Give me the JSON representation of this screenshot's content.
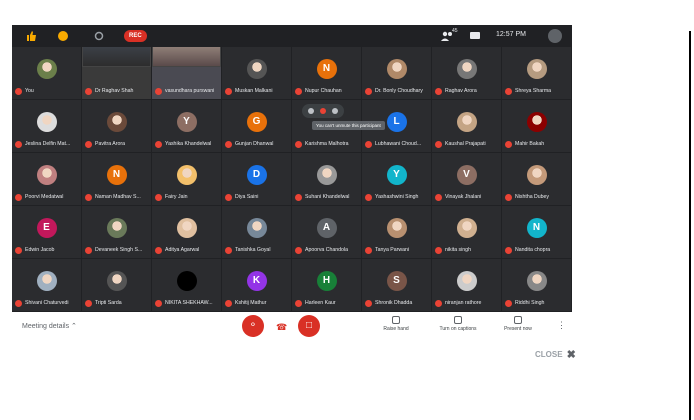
{
  "topbar": {
    "rec_label": "REC",
    "time": "12:57 PM",
    "participant_count": "45"
  },
  "tiles": [
    {
      "name": "You",
      "type": "photo",
      "color": "#6b7f4a"
    },
    {
      "name": "Dr Raghav Shah",
      "type": "video"
    },
    {
      "name": "vasundhara purswani",
      "type": "video"
    },
    {
      "name": "Muskan Malkani",
      "type": "photo",
      "color": "#555"
    },
    {
      "name": "Nupur Chauhan",
      "type": "letter",
      "letter": "N",
      "color": "#e8710a"
    },
    {
      "name": "Dr. Bonly Choudhary",
      "type": "photo",
      "color": "#b08968"
    },
    {
      "name": "Raghav Arora",
      "type": "photo",
      "color": "#777"
    },
    {
      "name": "Shreya Sharma",
      "type": "photo",
      "color": "#b59b80"
    },
    {
      "name": "Jeslina Delfin Mat...",
      "type": "photo",
      "color": "#ddd"
    },
    {
      "name": "Pavitra Arora",
      "type": "photo",
      "color": "#6b4a3a"
    },
    {
      "name": "Yashika Khandelwal",
      "type": "letter",
      "letter": "Y",
      "color": "#8d6e63"
    },
    {
      "name": "Gunjan Dhanwal",
      "type": "letter",
      "letter": "G",
      "color": "#e8710a"
    },
    {
      "name": "Karishma Malhotra",
      "type": "letter",
      "letter": "",
      "color": "#2b2c2f"
    },
    {
      "name": "Lubhawani Choud...",
      "type": "letter",
      "letter": "L",
      "color": "#1a73e8"
    },
    {
      "name": "Kaushal Prajapati",
      "type": "photo",
      "color": "#c4a484"
    },
    {
      "name": "Mahir Bakah",
      "type": "photo",
      "color": "#8b0000"
    },
    {
      "name": "Poorvi Medatwal",
      "type": "photo",
      "color": "#c08080"
    },
    {
      "name": "Naman Madhav S...",
      "type": "letter",
      "letter": "N",
      "color": "#e8710a"
    },
    {
      "name": "Fairy Jain",
      "type": "photo",
      "color": "#f3c06b"
    },
    {
      "name": "Diya Saini",
      "type": "letter",
      "letter": "D",
      "color": "#1a73e8"
    },
    {
      "name": "Suhani Khandelwal",
      "type": "photo",
      "color": "#999"
    },
    {
      "name": "Yashashwini Singh",
      "type": "letter",
      "letter": "Y",
      "color": "#12b5cb"
    },
    {
      "name": "Vinayak Jhalani",
      "type": "letter",
      "letter": "V",
      "color": "#8d6e63"
    },
    {
      "name": "Nishtha Dubey",
      "type": "photo",
      "color": "#c49a7a"
    },
    {
      "name": "Edwin Jacob",
      "type": "letter",
      "letter": "E",
      "color": "#c2185b"
    },
    {
      "name": "Devaneek Singh S...",
      "type": "photo",
      "color": "#6a7a5a"
    },
    {
      "name": "Aditya Agarwal",
      "type": "photo",
      "color": "#e0c0a0"
    },
    {
      "name": "Tanishka Goyal",
      "type": "photo",
      "color": "#778899"
    },
    {
      "name": "Apoorva Chandola",
      "type": "letter",
      "letter": "A",
      "color": "#5f6368"
    },
    {
      "name": "Tanya Parwani",
      "type": "photo",
      "color": "#b89070"
    },
    {
      "name": "nikita singh",
      "type": "photo",
      "color": "#d0b090"
    },
    {
      "name": "Nandita chopra",
      "type": "letter",
      "letter": "N",
      "color": "#12b5cb"
    },
    {
      "name": "Shivani Chaturvedi",
      "type": "photo",
      "color": "#a0b0c0"
    },
    {
      "name": "Tripti Sarda",
      "type": "photo",
      "color": "#555"
    },
    {
      "name": "NIKITA SHEKHAW...",
      "type": "letter",
      "letter": "",
      "color": "#000000"
    },
    {
      "name": "Kshitij Mathur",
      "type": "letter",
      "letter": "K",
      "color": "#9334e6"
    },
    {
      "name": "Harleen Kaur",
      "type": "letter",
      "letter": "H",
      "color": "#188038"
    },
    {
      "name": "Shronik Dhadda",
      "type": "letter",
      "letter": "S",
      "color": "#795548"
    },
    {
      "name": "niranjan rathore",
      "type": "photo",
      "color": "#ccc"
    },
    {
      "name": "Riddhi Singh",
      "type": "photo",
      "color": "#888"
    }
  ],
  "tooltip": "You can't unmute this participant",
  "bottom": {
    "meeting_details": "Meeting details",
    "raise_hand": "Raise hand",
    "captions": "Turn on captions",
    "present": "Present now"
  },
  "close_label": "CLOSE"
}
